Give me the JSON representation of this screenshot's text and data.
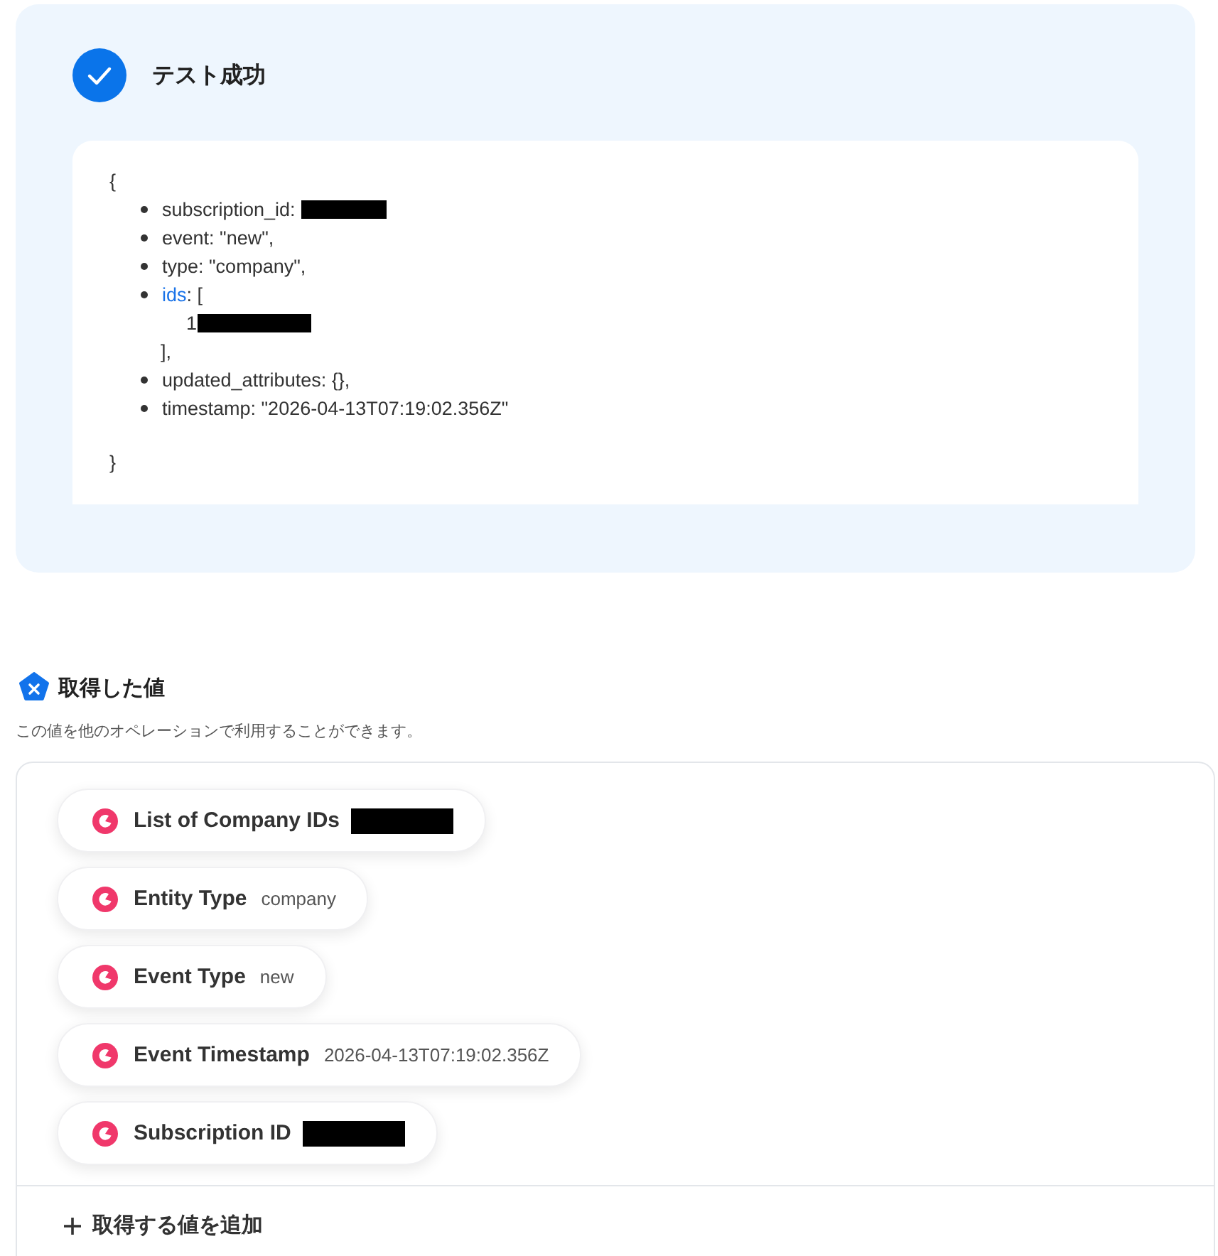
{
  "test_result": {
    "passed": true,
    "title": "テスト成功",
    "lines": [
      {
        "kind": "brace",
        "text": "{"
      },
      {
        "kind": "bullet",
        "text": "subscription_id: ",
        "redacted": true
      },
      {
        "kind": "bullet",
        "text": "event: \"new\","
      },
      {
        "kind": "bullet",
        "text": "type: \"company\","
      },
      {
        "kind": "bullet",
        "link": "ids",
        "text": ": ["
      },
      {
        "kind": "nested",
        "text": "1",
        "redacted": true
      },
      {
        "kind": "continuation",
        "text": "],"
      },
      {
        "kind": "bullet",
        "text": "updated_attributes: {},"
      },
      {
        "kind": "bullet",
        "text": "timestamp: \"2026-04-13T07:19:02.356Z\""
      },
      {
        "kind": "gap"
      },
      {
        "kind": "brace",
        "text": "}"
      }
    ]
  },
  "fetched_values": {
    "title": "取得した値",
    "description": "この値を他のオペレーションで利用することができます。",
    "items": [
      {
        "label": "List of Company IDs",
        "redacted": true
      },
      {
        "label": "Entity Type",
        "value": "company"
      },
      {
        "label": "Event Type",
        "value": "new"
      },
      {
        "label": "Event Timestamp",
        "value": "2026-04-13T07:19:02.356Z"
      },
      {
        "label": "Subscription ID",
        "redacted": true
      }
    ],
    "add_button": "取得する値を追加"
  }
}
